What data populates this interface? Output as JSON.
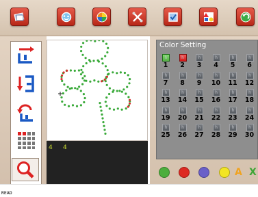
{
  "toolbar": {
    "buttons": [
      {
        "id": "new-project",
        "icon": "document-icon"
      },
      {
        "id": "open-gallery",
        "icon": "gallery-icon"
      },
      {
        "id": "color-wheel",
        "icon": "color-wheel-icon"
      },
      {
        "id": "tools",
        "icon": "tools-icon"
      },
      {
        "id": "checklist",
        "icon": "checklist-icon"
      },
      {
        "id": "shapes",
        "icon": "shapes-icon"
      },
      {
        "id": "undo",
        "icon": "undo-icon"
      }
    ]
  },
  "side_tools": [
    {
      "icon": "flow-right-icon"
    },
    {
      "icon": "flow-loop-icon"
    },
    {
      "icon": "reverse-icon"
    },
    {
      "icon": "grid-icon"
    },
    {
      "icon": "zoom-icon"
    }
  ],
  "color_setting": {
    "title": "Color Setting",
    "swatch_glyph": "h",
    "slots": [
      {
        "n": "1",
        "state": "green"
      },
      {
        "n": "2",
        "state": "red"
      },
      {
        "n": "3",
        "state": "off"
      },
      {
        "n": "4",
        "state": "off"
      },
      {
        "n": "5",
        "state": "off"
      },
      {
        "n": "6",
        "state": "off"
      },
      {
        "n": "7",
        "state": "off"
      },
      {
        "n": "8",
        "state": "off"
      },
      {
        "n": "9",
        "state": "off"
      },
      {
        "n": "10",
        "state": "off"
      },
      {
        "n": "11",
        "state": "off"
      },
      {
        "n": "12",
        "state": "off"
      },
      {
        "n": "13",
        "state": "off"
      },
      {
        "n": "14",
        "state": "off"
      },
      {
        "n": "15",
        "state": "off"
      },
      {
        "n": "16",
        "state": "off"
      },
      {
        "n": "17",
        "state": "off"
      },
      {
        "n": "18",
        "state": "off"
      },
      {
        "n": "19",
        "state": "off"
      },
      {
        "n": "20",
        "state": "off"
      },
      {
        "n": "21",
        "state": "off"
      },
      {
        "n": "22",
        "state": "off"
      },
      {
        "n": "23",
        "state": "off"
      },
      {
        "n": "24",
        "state": "off"
      },
      {
        "n": "25",
        "state": "off"
      },
      {
        "n": "26",
        "state": "off"
      },
      {
        "n": "27",
        "state": "off"
      },
      {
        "n": "28",
        "state": "off"
      },
      {
        "n": "29",
        "state": "off"
      },
      {
        "n": "30",
        "state": "off"
      }
    ]
  },
  "palette": [
    {
      "type": "circle",
      "color": "#4cae3c"
    },
    {
      "type": "circle",
      "color": "#dd2a22"
    },
    {
      "type": "circle",
      "color": "#6a5fc8"
    },
    {
      "type": "circle",
      "color": "#f2e524"
    },
    {
      "type": "letter",
      "text": "A",
      "color": "#f0a320"
    },
    {
      "type": "letter",
      "text": "X",
      "color": "#3ea536"
    }
  ],
  "timeline": {
    "markers": [
      "4",
      "4"
    ]
  },
  "status": {
    "text": "READ"
  },
  "colors": {
    "toolbar_bg": "#dccbb9",
    "button_red": "#c83424",
    "swatch_off": "#676a70",
    "swatch_on_green": "#66c456",
    "swatch_on_red": "#e02424",
    "dot_green": "#3aaa3a",
    "dot_red": "#d83030",
    "timeline_bg": "#222222",
    "settings_bg": "#8e8e8e"
  }
}
